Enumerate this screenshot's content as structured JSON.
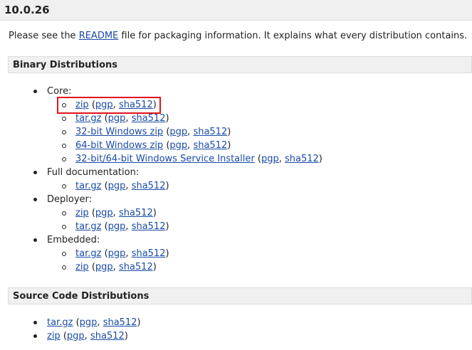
{
  "version": "10.0.26",
  "intro": {
    "before": "Please see the ",
    "readme": "README",
    "after": " file for packaging information. It explains what every distribution contains."
  },
  "binary_section": {
    "title": "Binary Distributions",
    "groups": [
      {
        "label": "Core:",
        "items": [
          {
            "main": "zip",
            "pgp": "pgp",
            "sha": "sha512"
          },
          {
            "main": "tar.gz",
            "pgp": "pgp",
            "sha": "sha512"
          },
          {
            "main": "32-bit Windows zip",
            "pgp": "pgp",
            "sha": "sha512"
          },
          {
            "main": "64-bit Windows zip",
            "pgp": "pgp",
            "sha": "sha512"
          },
          {
            "main": "32-bit/64-bit Windows Service Installer",
            "pgp": "pgp",
            "sha": "sha512"
          }
        ]
      },
      {
        "label": "Full documentation:",
        "items": [
          {
            "main": "tar.gz",
            "pgp": "pgp",
            "sha": "sha512"
          }
        ]
      },
      {
        "label": "Deployer:",
        "items": [
          {
            "main": "zip",
            "pgp": "pgp",
            "sha": "sha512"
          },
          {
            "main": "tar.gz",
            "pgp": "pgp",
            "sha": "sha512"
          }
        ]
      },
      {
        "label": "Embedded:",
        "items": [
          {
            "main": "tar.gz",
            "pgp": "pgp",
            "sha": "sha512"
          },
          {
            "main": "zip",
            "pgp": "pgp",
            "sha": "sha512"
          }
        ]
      }
    ]
  },
  "source_section": {
    "title": "Source Code Distributions",
    "items": [
      {
        "main": "tar.gz",
        "pgp": "pgp",
        "sha": "sha512"
      },
      {
        "main": "zip",
        "pgp": "pgp",
        "sha": "sha512"
      }
    ]
  },
  "punct": {
    "open": " (",
    "comma": ", ",
    "close": ")"
  },
  "colors": {
    "link": "#1a4ba8",
    "highlight": "#e0141b",
    "header_bg": "#f0f0f0"
  }
}
